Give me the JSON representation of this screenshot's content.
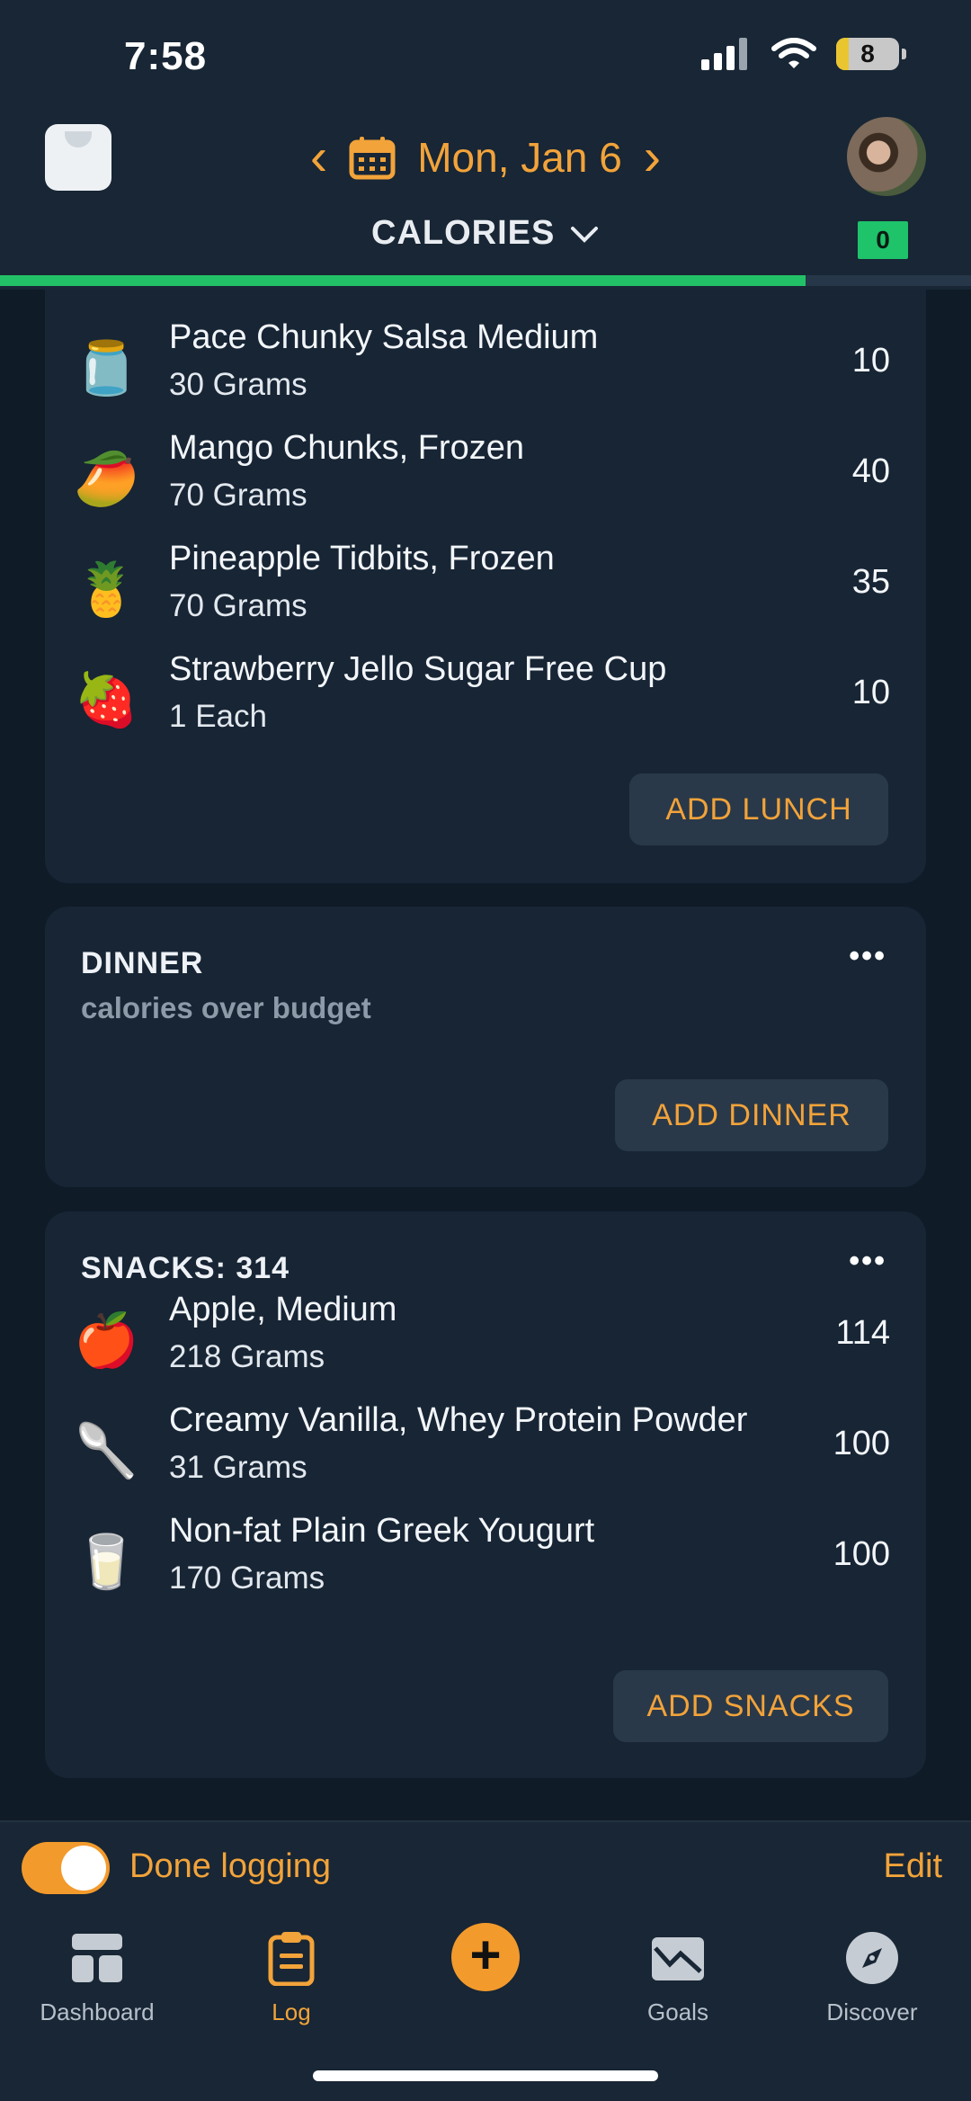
{
  "status_bar": {
    "time": "7:58",
    "battery": "8"
  },
  "header": {
    "date": "Mon, Jan 6",
    "metric_label": "CALORIES",
    "badge_value": "0",
    "progress_fraction": 0.83
  },
  "lunch": {
    "items": [
      {
        "name": "Pace Chunky Salsa Medium",
        "qty": "30 Grams",
        "cal": "10",
        "icon": "salsa-jar"
      },
      {
        "name": "Mango Chunks, Frozen",
        "qty": "70 Grams",
        "cal": "40",
        "icon": "mango"
      },
      {
        "name": "Pineapple Tidbits, Frozen",
        "qty": "70 Grams",
        "cal": "35",
        "icon": "pineapple"
      },
      {
        "name": "Strawberry Jello Sugar Free Cup",
        "qty": "1 Each",
        "cal": "10",
        "icon": "strawberry"
      }
    ],
    "add_label": "ADD LUNCH"
  },
  "dinner": {
    "title": "DINNER",
    "subtitle": "calories over budget",
    "menu": "•••",
    "add_label": "ADD DINNER"
  },
  "snacks": {
    "title": "SNACKS: 314",
    "menu": "•••",
    "items": [
      {
        "name": "Apple, Medium",
        "qty": "218 Grams",
        "cal": "114",
        "icon": "apple"
      },
      {
        "name": "Creamy Vanilla, Whey Protein Powder",
        "qty": "31 Grams",
        "cal": "100",
        "icon": "protein-scoop"
      },
      {
        "name": "Non-fat Plain Greek Yougurt",
        "qty": "170 Grams",
        "cal": "100",
        "icon": "yogurt-cup"
      }
    ],
    "add_label": "ADD SNACKS"
  },
  "done_bar": {
    "label": "Done logging",
    "edit": "Edit",
    "toggle_on": true
  },
  "tabbar": {
    "tabs": [
      {
        "label": "Dashboard",
        "icon": "dashboard-icon",
        "active": false
      },
      {
        "label": "Log",
        "icon": "clipboard-icon",
        "active": true
      },
      {
        "label": "Goals",
        "icon": "chart-icon",
        "active": false
      },
      {
        "label": "Discover",
        "icon": "compass-icon",
        "active": false
      }
    ],
    "add_icon": "+"
  },
  "colors": {
    "accent": "#f2a33a",
    "success": "#23c167",
    "background": "#0f1b27",
    "card": "#172535"
  }
}
